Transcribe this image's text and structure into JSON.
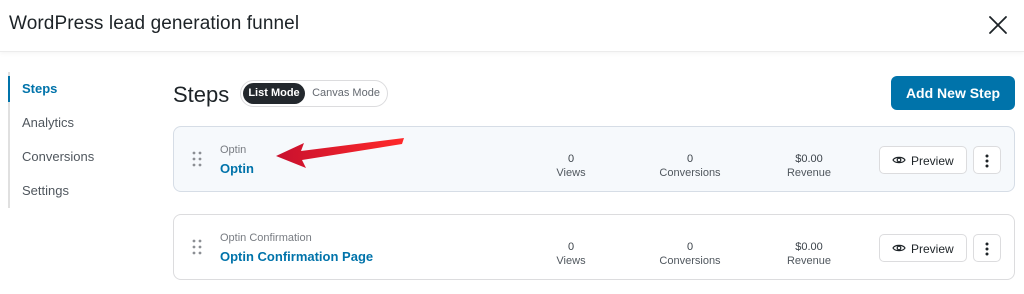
{
  "header": {
    "title": "WordPress lead generation funnel",
    "close_icon": "close-icon"
  },
  "sidebar": {
    "items": [
      {
        "label": "Steps",
        "active": true
      },
      {
        "label": "Analytics",
        "active": false
      },
      {
        "label": "Conversions",
        "active": false
      },
      {
        "label": "Settings",
        "active": false
      }
    ]
  },
  "main": {
    "heading": "Steps",
    "modes": {
      "list": "List Mode",
      "canvas": "Canvas Mode",
      "selected": "List Mode"
    },
    "add_button": "Add New Step",
    "steps": [
      {
        "type": "Optin",
        "name": "Optin",
        "views": "0",
        "views_label": "Views",
        "conversions": "0",
        "conversions_label": "Conversions",
        "revenue": "$0.00",
        "revenue_label": "Revenue",
        "preview_label": "Preview"
      },
      {
        "type": "Optin Confirmation",
        "name": "Optin Confirmation Page",
        "views": "0",
        "views_label": "Views",
        "conversions": "0",
        "conversions_label": "Conversions",
        "revenue": "$0.00",
        "revenue_label": "Revenue",
        "preview_label": "Preview"
      }
    ]
  },
  "colors": {
    "accent": "#0073aa",
    "annotation_arrow": "#e11d1d",
    "toggle_active": "#23282d"
  },
  "icons": [
    "close-icon",
    "drag-handle-icon",
    "eye-icon",
    "more-vertical-icon",
    "annotation-arrow"
  ]
}
